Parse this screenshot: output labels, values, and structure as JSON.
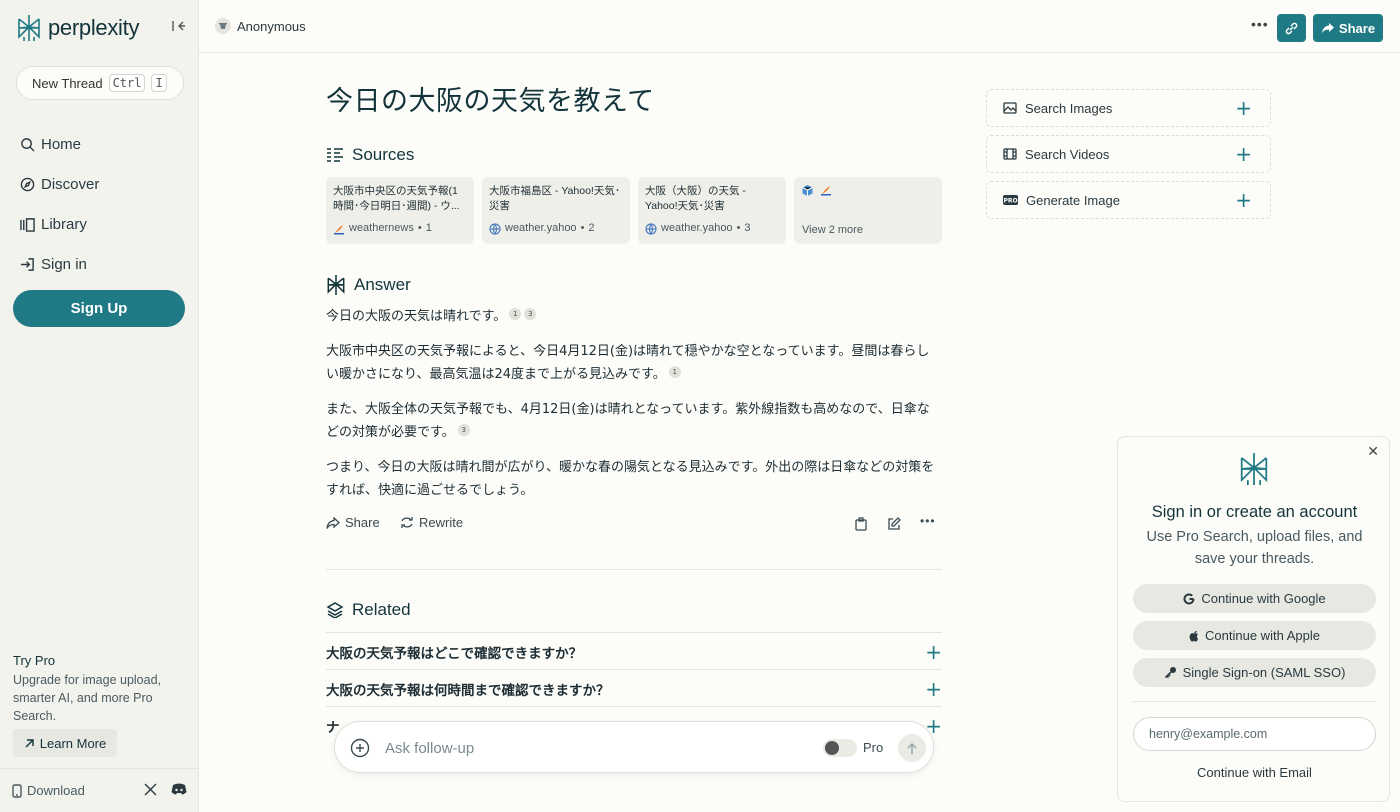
{
  "sidebar": {
    "logo_text": "perplexity",
    "new_thread": {
      "label": "New Thread",
      "key1": "Ctrl",
      "key2": "I"
    },
    "nav": [
      {
        "label": "Home",
        "icon": "search-icon"
      },
      {
        "label": "Discover",
        "icon": "compass-icon"
      },
      {
        "label": "Library",
        "icon": "library-icon"
      },
      {
        "label": "Sign in",
        "icon": "sign-in-icon"
      }
    ],
    "signup_label": "Sign Up",
    "trypro": {
      "title": "Try Pro",
      "text": "Upgrade for image upload, smarter AI, and more Pro Search."
    },
    "learn_more": "Learn More",
    "download": "Download"
  },
  "topbar": {
    "user": "Anonymous",
    "share_label": "Share"
  },
  "thread": {
    "title": "今日の大阪の天気を教えて",
    "sources_heading": "Sources",
    "sources": [
      {
        "title": "大阪市中央区の天気予報(1時間･今日明日･週間) - ウ...",
        "site": "weathernews",
        "num": "1"
      },
      {
        "title": "大阪市福島区 - Yahoo!天気･災害",
        "site": "weather.yahoo",
        "num": "2"
      },
      {
        "title": "大阪（大阪）の天気 - Yahoo!天気･災害",
        "site": "weather.yahoo",
        "num": "3"
      }
    ],
    "view_more": "View 2 more",
    "answer_heading": "Answer",
    "answer": {
      "p1": "今日の大阪の天気は晴れです。",
      "p2": "大阪市中央区の天気予報によると、今日4月12日(金)は晴れて穏やかな空となっています。昼間は春らしい暖かさになり、最高気温は24度まで上がる見込みです。",
      "p3": "また、大阪全体の天気予報でも、4月12日(金)は晴れとなっています。紫外線指数も高めなので、日傘などの対策が必要です。",
      "p4": "つまり、今日の大阪は晴れ間が広がり、暖かな春の陽気となる見込みです。外出の際は日傘などの対策をすれば、快適に過ごせるでしょう。",
      "cite1": "1",
      "cite3": "3"
    },
    "actions": {
      "share": "Share",
      "rewrite": "Rewrite"
    },
    "related_heading": "Related",
    "related": [
      "大阪の天気予報はどこで確認できますか？",
      "大阪の天気予報は何時間まで確認できますか？",
      "ナ"
    ]
  },
  "followup": {
    "placeholder": "Ask follow-up",
    "pro_label": "Pro"
  },
  "media": [
    {
      "label": "Search Images",
      "icon": "image-icon"
    },
    {
      "label": "Search Videos",
      "icon": "video-icon"
    },
    {
      "label": "Generate Image",
      "icon": "pro-icon"
    }
  ],
  "signin_card": {
    "title": "Sign in or create an account",
    "subtitle": "Use Pro Search, upload files, and save your threads.",
    "google": "Continue with Google",
    "apple": "Continue with Apple",
    "sso": "Single Sign-on (SAML SSO)",
    "email_placeholder": "henry@example.com",
    "continue_email": "Continue with Email"
  },
  "colors": {
    "accent": "#1f7a85",
    "background": "#fcfcf9",
    "sidebar": "#f3f3ee"
  }
}
